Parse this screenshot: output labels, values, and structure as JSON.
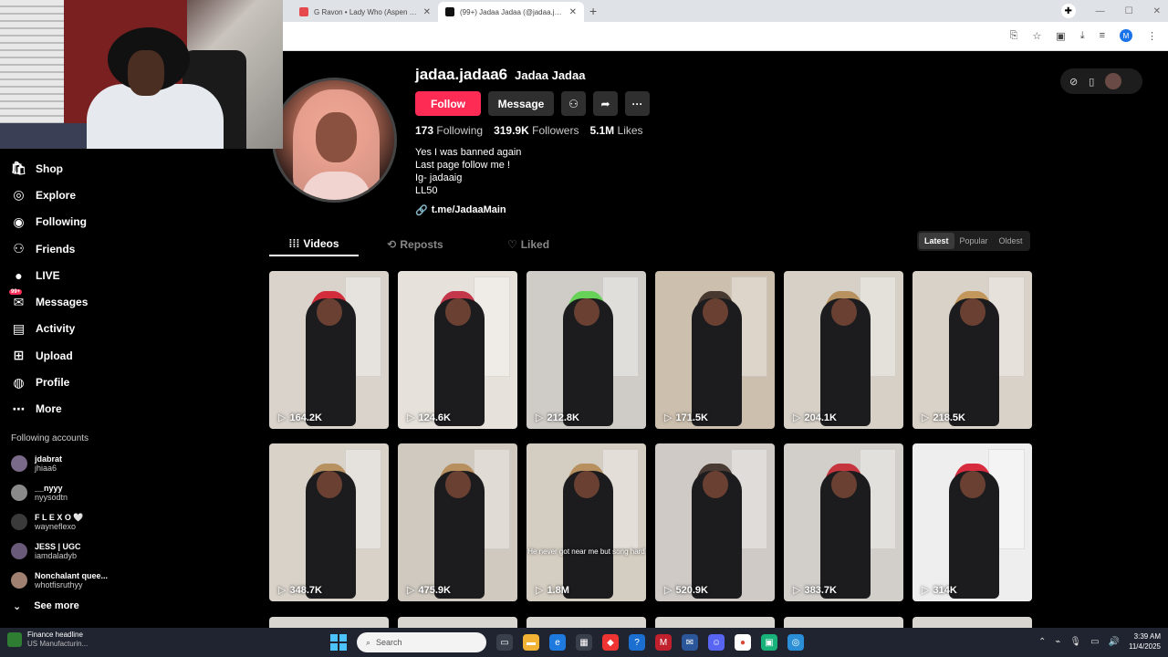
{
  "browser": {
    "tabs": [
      {
        "title": "G Ravon • Lady Who (Aspen Ki...",
        "active": false,
        "color": "#e5484d"
      },
      {
        "title": "(99+) Jadaa Jadaa (@jadaa.jadaa...",
        "active": true,
        "color": "#111111"
      }
    ],
    "new_tab": "+",
    "win_controls": [
      "—",
      "☐",
      "✕"
    ],
    "profile_initial": "M"
  },
  "sidebar": {
    "items": [
      {
        "label": "Shop",
        "icon": "shop-icon"
      },
      {
        "label": "Explore",
        "icon": "compass-icon"
      },
      {
        "label": "Following",
        "icon": "following-icon"
      },
      {
        "label": "Friends",
        "icon": "friends-icon"
      },
      {
        "label": "LIVE",
        "icon": "live-icon"
      },
      {
        "label": "Messages",
        "icon": "messages-icon",
        "badge": "99+"
      },
      {
        "label": "Activity",
        "icon": "activity-icon"
      },
      {
        "label": "Upload",
        "icon": "upload-icon"
      },
      {
        "label": "Profile",
        "icon": "profile-icon"
      },
      {
        "label": "More",
        "icon": "more-icon"
      }
    ],
    "following_heading": "Following accounts",
    "accounts": [
      {
        "name": "jdabrat",
        "handle": "jhiaa6"
      },
      {
        "name": "__nyyy",
        "handle": "nyysodtn"
      },
      {
        "name": "F L E X O 🤍",
        "handle": "wayneflexo"
      },
      {
        "name": "JESS | UGC",
        "handle": "iamdaladyb"
      },
      {
        "name": "Nonchalant quee...",
        "handle": "whotfisruthyy"
      }
    ],
    "see_more": "See more"
  },
  "profile": {
    "username": "jadaa.jadaa6",
    "nickname": "Jadaa Jadaa",
    "follow_label": "Follow",
    "message_label": "Message",
    "following_count": "173",
    "following_label": "Following",
    "followers_count": "319.9K",
    "followers_label": "Followers",
    "likes_count": "5.1M",
    "likes_label": "Likes",
    "bio": [
      "Yes I was banned again",
      "Last page follow me !",
      "Ig- jadaaig",
      "LL50"
    ],
    "link": "t.me/JadaaMain"
  },
  "tabs": {
    "videos": "Videos",
    "reposts": "Reposts",
    "liked": "Liked"
  },
  "sort": {
    "latest": "Latest",
    "popular": "Popular",
    "oldest": "Oldest"
  },
  "videos": [
    {
      "views": "164.2K",
      "bg": "#d9d3cb",
      "hair": "#d11a2a"
    },
    {
      "views": "124.6K",
      "bg": "#e6e1da",
      "hair": "#c0243a"
    },
    {
      "views": "212.8K",
      "bg": "#cfccc7",
      "hair": "#5bd34a"
    },
    {
      "views": "171.5K",
      "bg": "#cdbfae",
      "hair": "#3a2a22"
    },
    {
      "views": "204.1K",
      "bg": "#d6d0c7",
      "hair": "#b58a55"
    },
    {
      "views": "218.5K",
      "bg": "#d9d2c8",
      "hair": "#c09050"
    },
    {
      "views": "348.7K",
      "bg": "#d8d2c9",
      "hair": "#b58a55"
    },
    {
      "views": "475.9K",
      "bg": "#cfc9bf",
      "hair": "#b58a55"
    },
    {
      "views": "1.8M",
      "bg": "#d4cdc2",
      "hair": "#b58a55",
      "caption": "He never got near me but song hard"
    },
    {
      "views": "520.9K",
      "bg": "#cfcac6",
      "hair": "#3a2a22"
    },
    {
      "views": "383.7K",
      "bg": "#d2cfcb",
      "hair": "#c4232f"
    },
    {
      "views": "314K",
      "bg": "#eeeeee",
      "hair": "#d4152a"
    }
  ],
  "taskbar": {
    "news_title": "Finance headline",
    "news_sub": "US Manufacturin...",
    "search_placeholder": "Search",
    "time": "3:39 AM",
    "date": "11/4/2025"
  }
}
